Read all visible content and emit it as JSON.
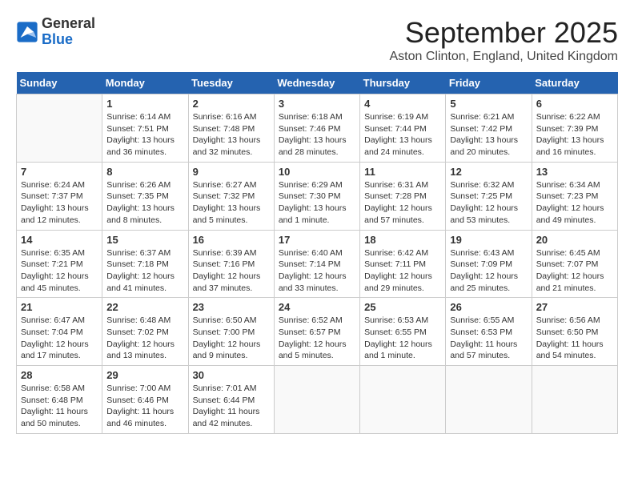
{
  "header": {
    "logo_general": "General",
    "logo_blue": "Blue",
    "month_title": "September 2025",
    "location": "Aston Clinton, England, United Kingdom"
  },
  "days_of_week": [
    "Sunday",
    "Monday",
    "Tuesday",
    "Wednesday",
    "Thursday",
    "Friday",
    "Saturday"
  ],
  "weeks": [
    [
      {
        "day": "",
        "info": ""
      },
      {
        "day": "1",
        "info": "Sunrise: 6:14 AM\nSunset: 7:51 PM\nDaylight: 13 hours\nand 36 minutes."
      },
      {
        "day": "2",
        "info": "Sunrise: 6:16 AM\nSunset: 7:48 PM\nDaylight: 13 hours\nand 32 minutes."
      },
      {
        "day": "3",
        "info": "Sunrise: 6:18 AM\nSunset: 7:46 PM\nDaylight: 13 hours\nand 28 minutes."
      },
      {
        "day": "4",
        "info": "Sunrise: 6:19 AM\nSunset: 7:44 PM\nDaylight: 13 hours\nand 24 minutes."
      },
      {
        "day": "5",
        "info": "Sunrise: 6:21 AM\nSunset: 7:42 PM\nDaylight: 13 hours\nand 20 minutes."
      },
      {
        "day": "6",
        "info": "Sunrise: 6:22 AM\nSunset: 7:39 PM\nDaylight: 13 hours\nand 16 minutes."
      }
    ],
    [
      {
        "day": "7",
        "info": "Sunrise: 6:24 AM\nSunset: 7:37 PM\nDaylight: 13 hours\nand 12 minutes."
      },
      {
        "day": "8",
        "info": "Sunrise: 6:26 AM\nSunset: 7:35 PM\nDaylight: 13 hours\nand 8 minutes."
      },
      {
        "day": "9",
        "info": "Sunrise: 6:27 AM\nSunset: 7:32 PM\nDaylight: 13 hours\nand 5 minutes."
      },
      {
        "day": "10",
        "info": "Sunrise: 6:29 AM\nSunset: 7:30 PM\nDaylight: 13 hours\nand 1 minute."
      },
      {
        "day": "11",
        "info": "Sunrise: 6:31 AM\nSunset: 7:28 PM\nDaylight: 12 hours\nand 57 minutes."
      },
      {
        "day": "12",
        "info": "Sunrise: 6:32 AM\nSunset: 7:25 PM\nDaylight: 12 hours\nand 53 minutes."
      },
      {
        "day": "13",
        "info": "Sunrise: 6:34 AM\nSunset: 7:23 PM\nDaylight: 12 hours\nand 49 minutes."
      }
    ],
    [
      {
        "day": "14",
        "info": "Sunrise: 6:35 AM\nSunset: 7:21 PM\nDaylight: 12 hours\nand 45 minutes."
      },
      {
        "day": "15",
        "info": "Sunrise: 6:37 AM\nSunset: 7:18 PM\nDaylight: 12 hours\nand 41 minutes."
      },
      {
        "day": "16",
        "info": "Sunrise: 6:39 AM\nSunset: 7:16 PM\nDaylight: 12 hours\nand 37 minutes."
      },
      {
        "day": "17",
        "info": "Sunrise: 6:40 AM\nSunset: 7:14 PM\nDaylight: 12 hours\nand 33 minutes."
      },
      {
        "day": "18",
        "info": "Sunrise: 6:42 AM\nSunset: 7:11 PM\nDaylight: 12 hours\nand 29 minutes."
      },
      {
        "day": "19",
        "info": "Sunrise: 6:43 AM\nSunset: 7:09 PM\nDaylight: 12 hours\nand 25 minutes."
      },
      {
        "day": "20",
        "info": "Sunrise: 6:45 AM\nSunset: 7:07 PM\nDaylight: 12 hours\nand 21 minutes."
      }
    ],
    [
      {
        "day": "21",
        "info": "Sunrise: 6:47 AM\nSunset: 7:04 PM\nDaylight: 12 hours\nand 17 minutes."
      },
      {
        "day": "22",
        "info": "Sunrise: 6:48 AM\nSunset: 7:02 PM\nDaylight: 12 hours\nand 13 minutes."
      },
      {
        "day": "23",
        "info": "Sunrise: 6:50 AM\nSunset: 7:00 PM\nDaylight: 12 hours\nand 9 minutes."
      },
      {
        "day": "24",
        "info": "Sunrise: 6:52 AM\nSunset: 6:57 PM\nDaylight: 12 hours\nand 5 minutes."
      },
      {
        "day": "25",
        "info": "Sunrise: 6:53 AM\nSunset: 6:55 PM\nDaylight: 12 hours\nand 1 minute."
      },
      {
        "day": "26",
        "info": "Sunrise: 6:55 AM\nSunset: 6:53 PM\nDaylight: 11 hours\nand 57 minutes."
      },
      {
        "day": "27",
        "info": "Sunrise: 6:56 AM\nSunset: 6:50 PM\nDaylight: 11 hours\nand 54 minutes."
      }
    ],
    [
      {
        "day": "28",
        "info": "Sunrise: 6:58 AM\nSunset: 6:48 PM\nDaylight: 11 hours\nand 50 minutes."
      },
      {
        "day": "29",
        "info": "Sunrise: 7:00 AM\nSunset: 6:46 PM\nDaylight: 11 hours\nand 46 minutes."
      },
      {
        "day": "30",
        "info": "Sunrise: 7:01 AM\nSunset: 6:44 PM\nDaylight: 11 hours\nand 42 minutes."
      },
      {
        "day": "",
        "info": ""
      },
      {
        "day": "",
        "info": ""
      },
      {
        "day": "",
        "info": ""
      },
      {
        "day": "",
        "info": ""
      }
    ]
  ]
}
